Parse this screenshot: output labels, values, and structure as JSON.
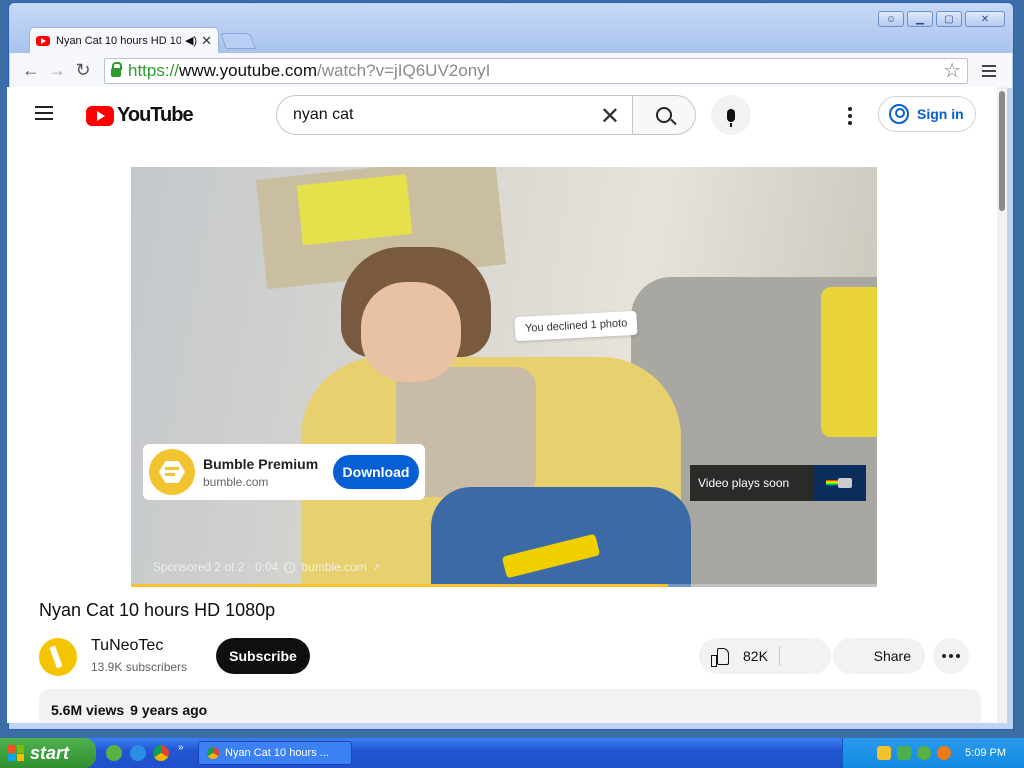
{
  "browser": {
    "tab_title": "Nyan Cat 10 hours HD 10",
    "url_scheme": "https://",
    "url_host": "www.youtube.com",
    "url_path": "/watch?v=jIQ6UV2onyI"
  },
  "youtube": {
    "logo_text": "YouTube",
    "search_query": "nyan cat",
    "sign_in_label": "Sign in"
  },
  "ad": {
    "overlay_text": "You declined 1 photo",
    "advertiser": "Bumble Premium",
    "domain": "bumble.com",
    "cta_label": "Download",
    "plays_soon_label": "Video plays soon",
    "sponsored_label": "Sponsored 2 of 2 · 0:04",
    "sponsored_link": "bumble.com",
    "progress_fraction": 0.72
  },
  "video": {
    "title": "Nyan Cat 10 hours HD 1080p",
    "channel_name": "TuNeoTec",
    "subscribers": "13.9K subscribers",
    "subscribe_label": "Subscribe",
    "likes": "82K",
    "share_label": "Share",
    "views": "5.6M views",
    "age": "9 years ago"
  },
  "taskbar": {
    "start_label": "start",
    "task_item": "Nyan Cat 10 hours ...",
    "clock": "5:09 PM"
  },
  "colors": {
    "youtube_red": "#ff0000",
    "link_blue": "#065fd4",
    "ad_progress": "#fbc02d",
    "xp_blue": "#2457d4",
    "xp_green": "#2f8f2f"
  }
}
